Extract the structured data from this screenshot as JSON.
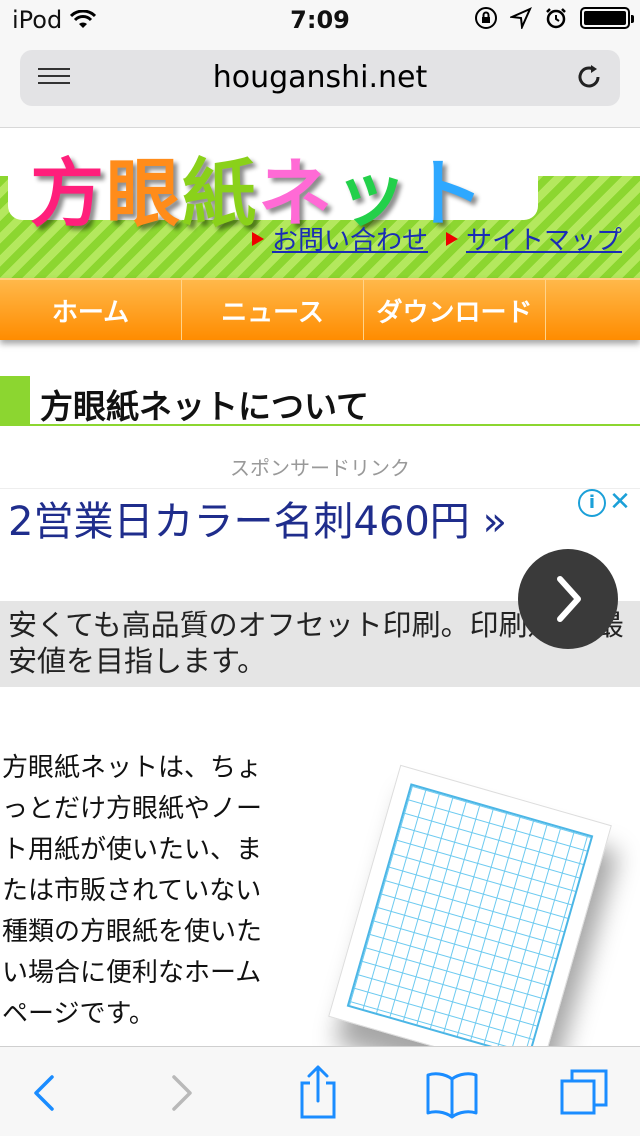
{
  "status_bar": {
    "carrier": "iPod",
    "time": "7:09"
  },
  "browser": {
    "url": "houganshi.net"
  },
  "site": {
    "logo_text": "方眼紙ネット",
    "top_links": [
      "お問い合わせ",
      "サイトマップ"
    ],
    "nav": [
      "ホーム",
      "ニュース",
      "ダウンロード"
    ]
  },
  "content": {
    "section_title": "方眼紙ネットについて",
    "sponsored_label": "スポンサードリンク",
    "ad": {
      "headline": "2営業日カラー名刺460円 »",
      "body": "安くても高品質のオフセット印刷。印刷通販 最安値を目指します。"
    },
    "intro": "方眼紙ネットは、ちょっとだけ方眼紙やノート用紙が使いたい、または市販されていない種類の方眼紙を使いたい場合に便利なホームページです。"
  },
  "colors": {
    "accent_green": "#8cd630",
    "nav_orange": "#ff8c00",
    "link_blue": "#1a2db5",
    "ios_blue": "#1a8cff"
  }
}
